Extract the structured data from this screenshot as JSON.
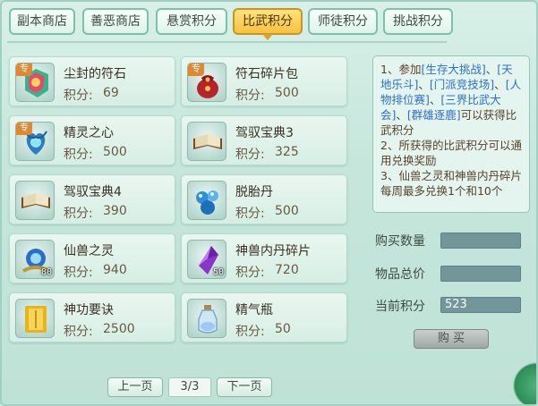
{
  "tabs": [
    {
      "label": "副本商店",
      "active": false
    },
    {
      "label": "善恶商店",
      "active": false
    },
    {
      "label": "悬赏积分",
      "active": false
    },
    {
      "label": "比武积分",
      "active": true
    },
    {
      "label": "师徒积分",
      "active": false
    },
    {
      "label": "挑战积分",
      "active": false
    }
  ],
  "items": [
    {
      "name": "尘封的符石",
      "points_label": "积分:",
      "points": "69",
      "icon": "runestone-icon",
      "badge": "专"
    },
    {
      "name": "符石碎片包",
      "points_label": "积分:",
      "points": "500",
      "icon": "red-pouch-icon",
      "badge": "专"
    },
    {
      "name": "精灵之心",
      "points_label": "积分:",
      "points": "500",
      "icon": "spirit-heart-icon",
      "badge": "专"
    },
    {
      "name": "驾驭宝典3",
      "points_label": "积分:",
      "points": "325",
      "icon": "book-icon",
      "badge": ""
    },
    {
      "name": "驾驭宝典4",
      "points_label": "积分:",
      "points": "390",
      "icon": "book-icon",
      "badge": ""
    },
    {
      "name": "脱胎丹",
      "points_label": "积分:",
      "points": "500",
      "icon": "pill-icon",
      "badge": ""
    },
    {
      "name": "仙兽之灵",
      "points_label": "积分:",
      "points": "940",
      "icon": "blue-orb-icon",
      "badge": "",
      "qty": "80"
    },
    {
      "name": "神兽内丹碎片",
      "points_label": "积分:",
      "points": "720",
      "icon": "purple-crystal-icon",
      "badge": "",
      "qty": "50"
    },
    {
      "name": "神功要诀",
      "points_label": "积分:",
      "points": "2500",
      "icon": "yellow-scroll-icon",
      "badge": ""
    },
    {
      "name": "精气瓶",
      "points_label": "积分:",
      "points": "50",
      "icon": "potion-bottle-icon",
      "badge": ""
    }
  ],
  "info": {
    "line1_a": "1、参加",
    "link1": "[生存大挑战]",
    "sep1": "、",
    "link2": "[天地乐斗]",
    "sep2": "、",
    "link3": "[门派竞技场]",
    "sep3": "、",
    "link4": "[人物排位赛]",
    "sep4": "、",
    "link5": "[三界比武大会]",
    "sep5": "、",
    "link6": "[群雄逐鹿]",
    "line1_b": "可以获得比武积分",
    "line2": "2、所获得的比武积分可以通用兑换奖励",
    "line3": "3、仙兽之灵和神兽内丹碎片每周最多兑换1个和10个"
  },
  "form": {
    "qty_label": "购买数量",
    "total_label": "物品总价",
    "current_label": "当前积分",
    "qty_value": "",
    "total_value": "",
    "current_value": "523"
  },
  "buttons": {
    "buy": "购 买",
    "prev": "上一页",
    "next": "下一页"
  },
  "pagination": {
    "indicator": "3/3"
  },
  "colors": {
    "active_tab": "#f6c23f",
    "link": "#2d70c9",
    "panel": "#c6e6dc"
  }
}
